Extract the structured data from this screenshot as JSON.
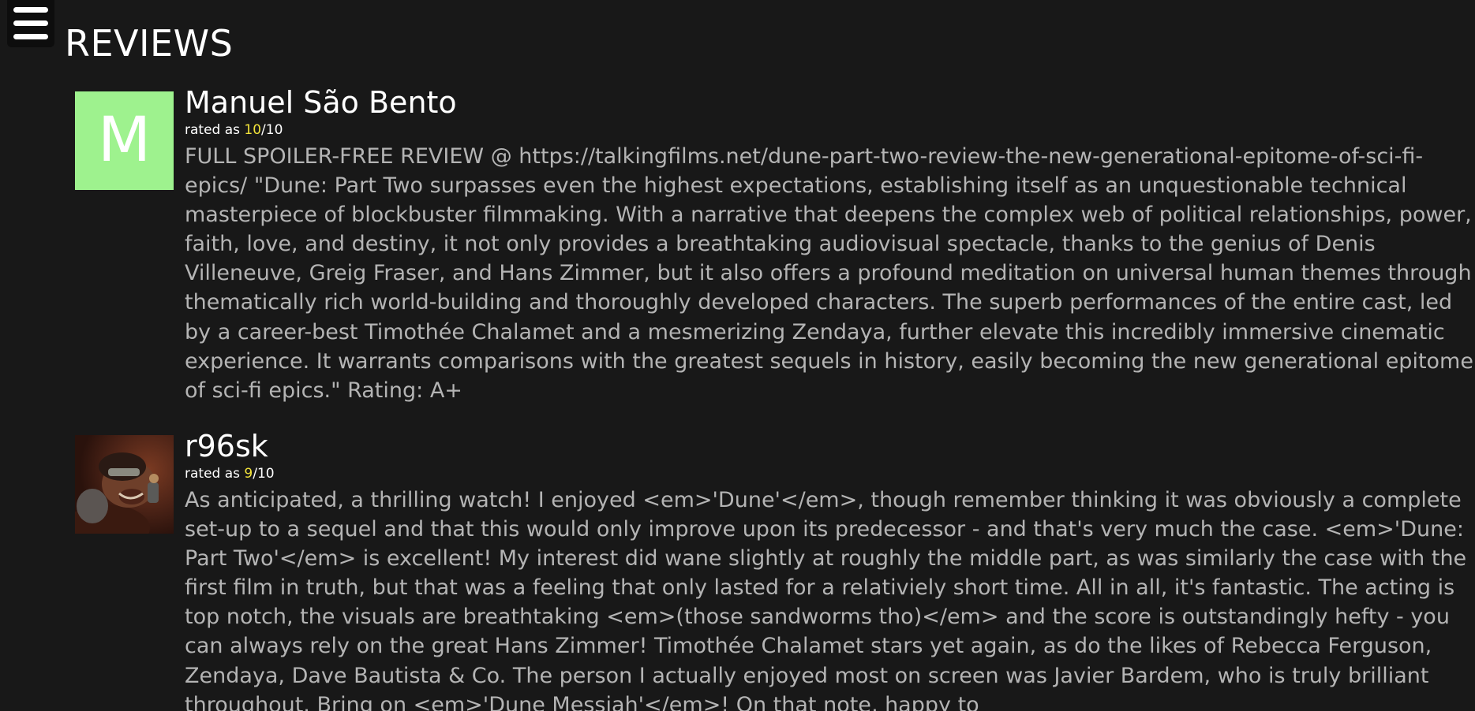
{
  "header": {
    "title": "REVIEWS"
  },
  "reviews": [
    {
      "author": "Manuel São Bento",
      "avatar_letter": "M",
      "rating_prefix": "rated as ",
      "rating_value": "10",
      "rating_suffix": "/10",
      "content": "FULL SPOILER-FREE REVIEW @ https://talkingfilms.net/dune-part-two-review-the-new-generational-epitome-of-sci-fi-epics/ \"Dune: Part Two surpasses even the highest expectations, establishing itself as an unquestionable technical masterpiece of blockbuster filmmaking. With a narrative that deepens the complex web of political relationships, power, faith, love, and destiny, it not only provides a breathtaking audiovisual spectacle, thanks to the genius of Denis Villeneuve, Greig Fraser, and Hans Zimmer, but it also offers a profound meditation on universal human themes through thematically rich world-building and thoroughly developed characters. The superb performances of the entire cast, led by a career-best Timothée Chalamet and a mesmerizing Zendaya, further elevate this incredibly immersive cinematic experience. It warrants comparisons with the greatest sequels in history, easily becoming the new generational epitome of sci-fi epics.\" Rating: A+"
    },
    {
      "author": "r96sk",
      "avatar_letter": "",
      "rating_prefix": "rated as ",
      "rating_value": "9",
      "rating_suffix": "/10",
      "content": "As anticipated, a thrilling watch! I enjoyed <em>'Dune'</em>, though remember thinking it was obviously a complete set-up to a sequel and that this would only improve upon its predecessor - and that's very much the case. <em>'Dune: Part Two'</em> is excellent! My interest did wane slightly at roughly the middle part, as was similarly the case with the first film in truth, but that was a feeling that only lasted for a relativiely short time. All in all, it's fantastic. The acting is top notch, the visuals are breathtaking <em>(those sandworms tho)</em> and the score is outstandingly hefty - you can always rely on the great Hans Zimmer! Timothée Chalamet stars yet again, as do the likes of Rebecca Ferguson, Zendaya, Dave Bautista & Co. The person I actually enjoyed most on screen was Javier Bardem, who is truly brilliant throughout. Bring on <em>'Dune Messiah'</em>! On that note, happy to"
    }
  ],
  "colors": {
    "background": "#181818",
    "avatar_bg": "#9ef28e",
    "rating_accent": "#f2e33a",
    "body_text": "#b4b4b4"
  },
  "icons": {
    "menu": "hamburger-menu-icon"
  }
}
